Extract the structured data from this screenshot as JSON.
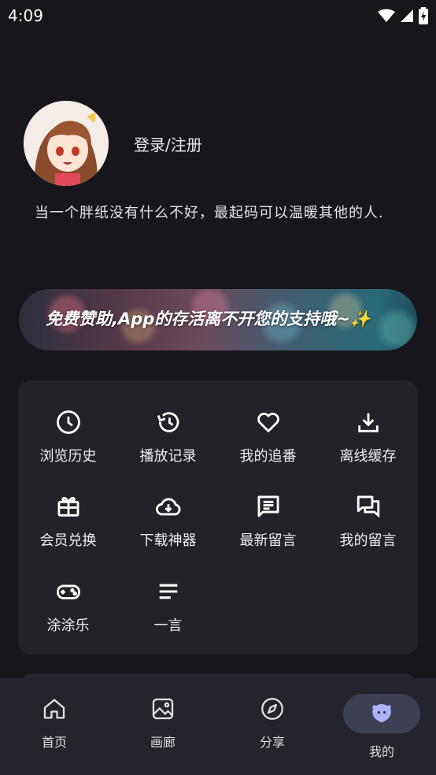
{
  "status_bar": {
    "time": "4:09"
  },
  "profile": {
    "login_label": "登录/注册"
  },
  "motto": "当一个胖纸没有什么不好，最起码可以温暖其他的人.",
  "banner": {
    "text": "免费赞助,App的存活离不开您的支持哦~✨"
  },
  "grid": [
    {
      "label": "浏览历史",
      "icon": "clock-icon"
    },
    {
      "label": "播放记录",
      "icon": "history-icon"
    },
    {
      "label": "我的追番",
      "icon": "heart-icon"
    },
    {
      "label": "离线缓存",
      "icon": "download-icon"
    },
    {
      "label": "会员兑换",
      "icon": "gift-icon"
    },
    {
      "label": "下载神器",
      "icon": "cloud-download-icon"
    },
    {
      "label": "最新留言",
      "icon": "message-icon"
    },
    {
      "label": "我的留言",
      "icon": "forum-icon"
    },
    {
      "label": "涂涂乐",
      "icon": "gamepad-icon"
    },
    {
      "label": "一言",
      "icon": "lines-icon"
    }
  ],
  "nav": [
    {
      "label": "首页",
      "icon": "home-icon"
    },
    {
      "label": "画廊",
      "icon": "gallery-icon"
    },
    {
      "label": "分享",
      "icon": "compass-icon"
    },
    {
      "label": "我的",
      "icon": "mascot-icon",
      "active": true
    }
  ],
  "colors": {
    "background": "#16161b",
    "panel": "#222229",
    "nav": "#24242c",
    "active_pill": "#3d3f52",
    "mascot": "#a9b4f5"
  }
}
